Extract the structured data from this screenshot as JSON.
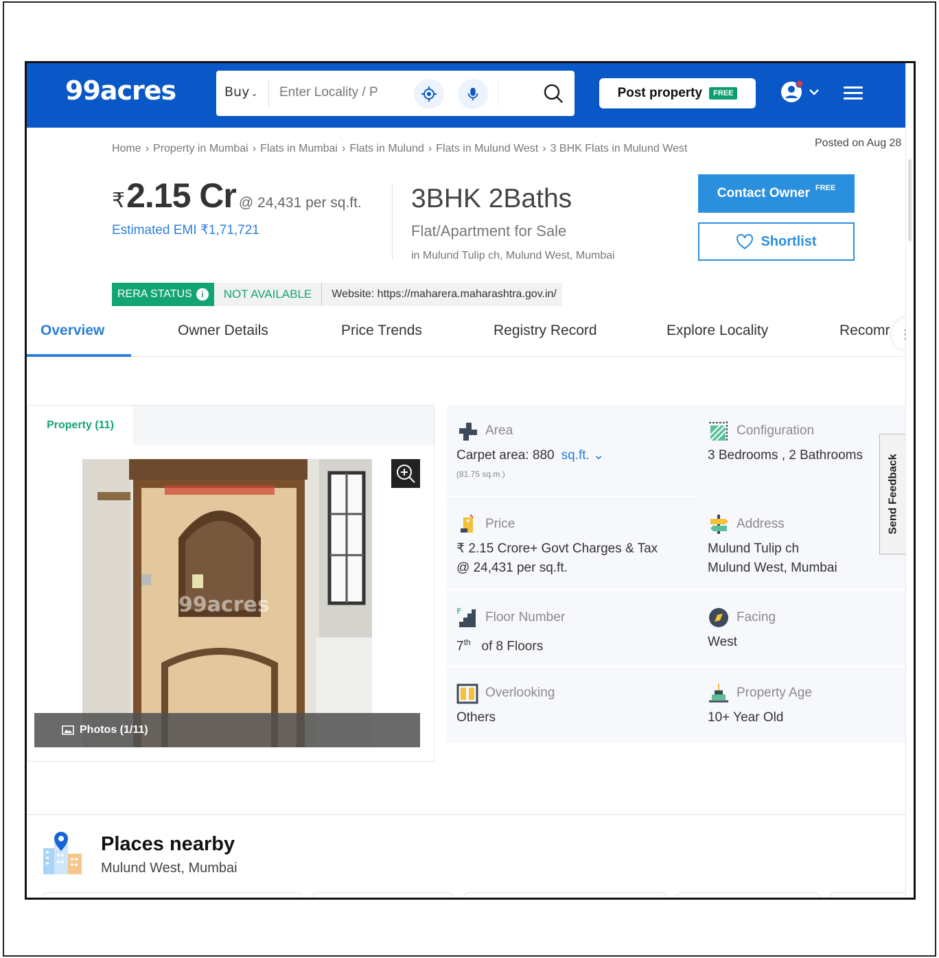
{
  "header": {
    "logo": "99acres",
    "buy_label": "Buy",
    "search_placeholder": "Enter Locality / P",
    "post_property_label": "Post property",
    "post_property_badge": "FREE"
  },
  "breadcrumb": [
    "Home",
    "Property in Mumbai",
    "Flats in Mumbai",
    "Flats in Mulund",
    "Flats in Mulund West",
    "3 BHK Flats in Mulund West"
  ],
  "posted_on": "Posted on Aug 28",
  "listing": {
    "currency_symbol": "₹",
    "price": "2.15 Cr",
    "price_per_sqft": "@ 24,431 per sq.ft.",
    "emi": "Estimated EMI ₹1,71,721",
    "title": "3BHK 2Baths",
    "type": "Flat/Apartment for Sale",
    "location": "in Mulund Tulip ch, Mulund West, Mumbai",
    "contact_label": "Contact Owner",
    "contact_badge": "FREE",
    "shortlist_label": "Shortlist"
  },
  "rera": {
    "status_label": "RERA STATUS",
    "status_value": "NOT AVAILABLE",
    "website": "Website: https://maharera.maharashtra.gov.in/"
  },
  "tabs": [
    "Overview",
    "Owner Details",
    "Price Trends",
    "Registry Record",
    "Explore Locality",
    "Recomr"
  ],
  "gallery": {
    "tab_label": "Property (11)",
    "photo_count": "Photos (1/11)",
    "watermark": "99acres"
  },
  "details": {
    "area": {
      "label": "Area",
      "value": "Carpet area: 880",
      "unit": "sq.ft.",
      "sub": "(81.75 sq.m.)"
    },
    "configuration": {
      "label": "Configuration",
      "value": "3 Bedrooms , 2 Bathrooms"
    },
    "price": {
      "label": "Price",
      "line1": "₹ 2.15 Crore+ Govt Charges & Tax",
      "line2": "@ 24,431 per sq.ft."
    },
    "address": {
      "label": "Address",
      "line1": "Mulund Tulip ch",
      "line2": "Mulund West, Mumbai"
    },
    "floor": {
      "label": "Floor Number",
      "floor_no": "7",
      "floor_suffix": "th",
      "total": "of 8 Floors"
    },
    "facing": {
      "label": "Facing",
      "value": "West"
    },
    "overlooking": {
      "label": "Overlooking",
      "value": "Others"
    },
    "age": {
      "label": "Property Age",
      "value": "10+ Year Old"
    }
  },
  "feedback_label": "Send Feedback",
  "places": {
    "title": "Places nearby",
    "subtitle": "Mulund West, Mumbai"
  },
  "colors": {
    "brand_blue": "#0a58c7",
    "accent_blue": "#2b7fd8",
    "rera_green": "#12a474"
  }
}
